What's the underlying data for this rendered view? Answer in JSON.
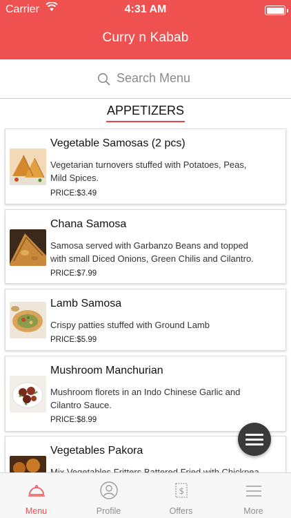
{
  "status_bar": {
    "carrier": "Carrier",
    "time": "4:31 AM"
  },
  "app": {
    "title": "Curry n Kabab",
    "accent_color": "#ef5050"
  },
  "search": {
    "placeholder": "Search Menu"
  },
  "section": {
    "title": "APPETIZERS"
  },
  "items": [
    {
      "name": "Vegetable Samosas (2 pcs)",
      "desc_lines": [
        "Vegetarian turnovers stuffed with Potatoes, Peas,",
        "Mild Spices."
      ],
      "price": "PRICE:$3.49",
      "image": "vegetable-samosa-photo"
    },
    {
      "name": "Chana Samosa",
      "desc_lines": [
        "Samosa served with Garbanzo Beans and topped",
        "with small Diced Onions, Green Chilis and Cilantro."
      ],
      "price": "PRICE:$7.99",
      "image": "chana-samosa-photo"
    },
    {
      "name": "Lamb Samosa",
      "desc_lines": [
        "Crispy patties stuffed with Ground Lamb"
      ],
      "price": "PRICE:$5.99",
      "image": "lamb-samosa-photo"
    },
    {
      "name": "Mushroom Manchurian",
      "desc_lines": [
        "Mushroom florets in an Indo Chinese Garlic and",
        "Cilantro Sauce."
      ],
      "price": "PRICE:$8.99",
      "image": "mushroom-manchurian-photo"
    },
    {
      "name": "Vegetables Pakora",
      "desc_lines": [
        "Mix Vegetables Fritters Battered Fried with Chickpea"
      ],
      "price": "",
      "image": "vegetable-pakora-photo"
    }
  ],
  "tabs": [
    {
      "label": "Menu",
      "icon": "cloche-icon",
      "active": true
    },
    {
      "label": "Profile",
      "icon": "profile-icon",
      "active": false
    },
    {
      "label": "Offers",
      "icon": "offers-icon",
      "active": false
    },
    {
      "label": "More",
      "icon": "more-icon",
      "active": false
    }
  ]
}
